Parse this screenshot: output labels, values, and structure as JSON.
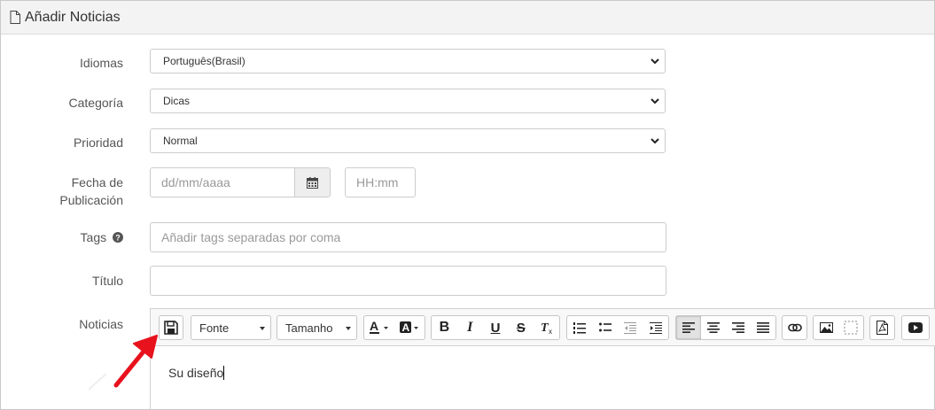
{
  "header": {
    "title": "Añadir Noticias",
    "icon": "document-icon"
  },
  "form": {
    "idiomas": {
      "label": "Idiomas",
      "value": "Português(Brasil)"
    },
    "categoria": {
      "label": "Categoría",
      "value": "Dicas"
    },
    "prioridad": {
      "label": "Prioridad",
      "value": "Normal"
    },
    "fecha": {
      "label_line1": "Fecha de",
      "label_line2": "Publicación",
      "date_placeholder": "dd/mm/aaaa",
      "time_placeholder": "HH:mm"
    },
    "tags": {
      "label": "Tags",
      "placeholder": "Añadir tags separadas por coma"
    },
    "titulo": {
      "label": "Título",
      "value": ""
    },
    "noticias": {
      "label": "Noticias"
    }
  },
  "editor": {
    "font_label": "Fonte",
    "size_label": "Tamanho",
    "content": "Su diseño"
  },
  "colors": {
    "annotation_arrow": "#e8121d",
    "toolbar_bg": "#f8f8f8",
    "header_bg": "#f3f3f3"
  }
}
